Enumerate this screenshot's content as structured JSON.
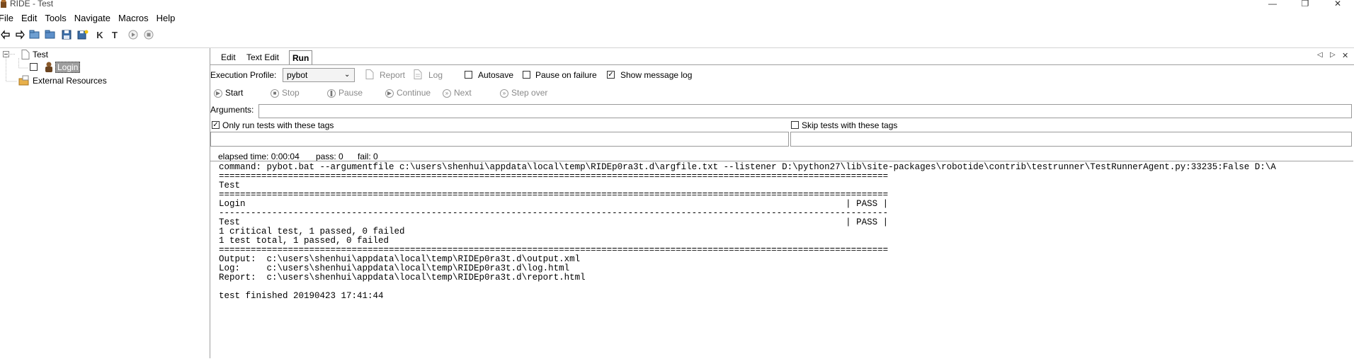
{
  "window": {
    "title": "RIDE - Test",
    "minimize": "—",
    "maximize": "❐",
    "close": "✕"
  },
  "menubar": {
    "items": [
      "File",
      "Edit",
      "Tools",
      "Navigate",
      "Macros",
      "Help"
    ]
  },
  "toolbar": {
    "icons": [
      "back-icon",
      "forward-icon",
      "open-folder-icon",
      "open-directory-icon",
      "save-icon",
      "save-all-icon",
      "new-keyword-icon",
      "new-testcase-icon",
      "run-icon",
      "stop-icon"
    ],
    "k_label": "K",
    "t_label": "T"
  },
  "tree": {
    "root": "Test",
    "test_case": "Login",
    "resources": "External Resources"
  },
  "tabs": [
    "Edit",
    "Text Edit",
    "Run"
  ],
  "run": {
    "execution_profile_label": "Execution Profile:",
    "execution_profile_value": "pybot",
    "report_label": "Report",
    "log_label": "Log",
    "autosave_label": "Autosave",
    "pause_on_failure_label": "Pause on failure",
    "show_message_log_label": "Show message log",
    "start_label": "Start",
    "stop_label": "Stop",
    "pause_label": "Pause",
    "continue_label": "Continue",
    "next_label": "Next",
    "step_over_label": "Step over",
    "arguments_label": "Arguments:",
    "arguments_value": "",
    "only_run_tags_label": "Only run tests with these tags",
    "skip_tags_label": "Skip tests with these tags",
    "only_run_tags_value": "",
    "skip_tags_value": "",
    "elapsed_time": "elapsed time: 0:00:04",
    "pass_count": "pass: 0",
    "fail_count": "fail: 0",
    "autosave_checked": false,
    "pause_on_failure_checked": false,
    "show_message_log_checked": true,
    "only_run_tags_checked": true,
    "skip_tags_checked": false
  },
  "console": {
    "lines": [
      "command: pybot.bat --argumentfile c:\\users\\shenhui\\appdata\\local\\temp\\RIDEp0ra3t.d\\argfile.txt --listener D:\\python27\\lib\\site-packages\\robotide\\contrib\\testrunner\\TestRunnerAgent.py:33235:False D:\\A",
      "==============================================================================================================================",
      "Test",
      "==============================================================================================================================",
      "Login                                                                                                                 | PASS |",
      "------------------------------------------------------------------------------------------------------------------------------",
      "Test                                                                                                                  | PASS |",
      "1 critical test, 1 passed, 0 failed",
      "1 test total, 1 passed, 0 failed",
      "==============================================================================================================================",
      "Output:  c:\\users\\shenhui\\appdata\\local\\temp\\RIDEp0ra3t.d\\output.xml",
      "Log:     c:\\users\\shenhui\\appdata\\local\\temp\\RIDEp0ra3t.d\\log.html",
      "Report:  c:\\users\\shenhui\\appdata\\local\\temp\\RIDEp0ra3t.d\\report.html",
      "",
      "test finished 20190423 17:41:44"
    ]
  },
  "pane_controls": {
    "left_arrow": "◁",
    "right_arrow": "▷",
    "close": "✕"
  }
}
